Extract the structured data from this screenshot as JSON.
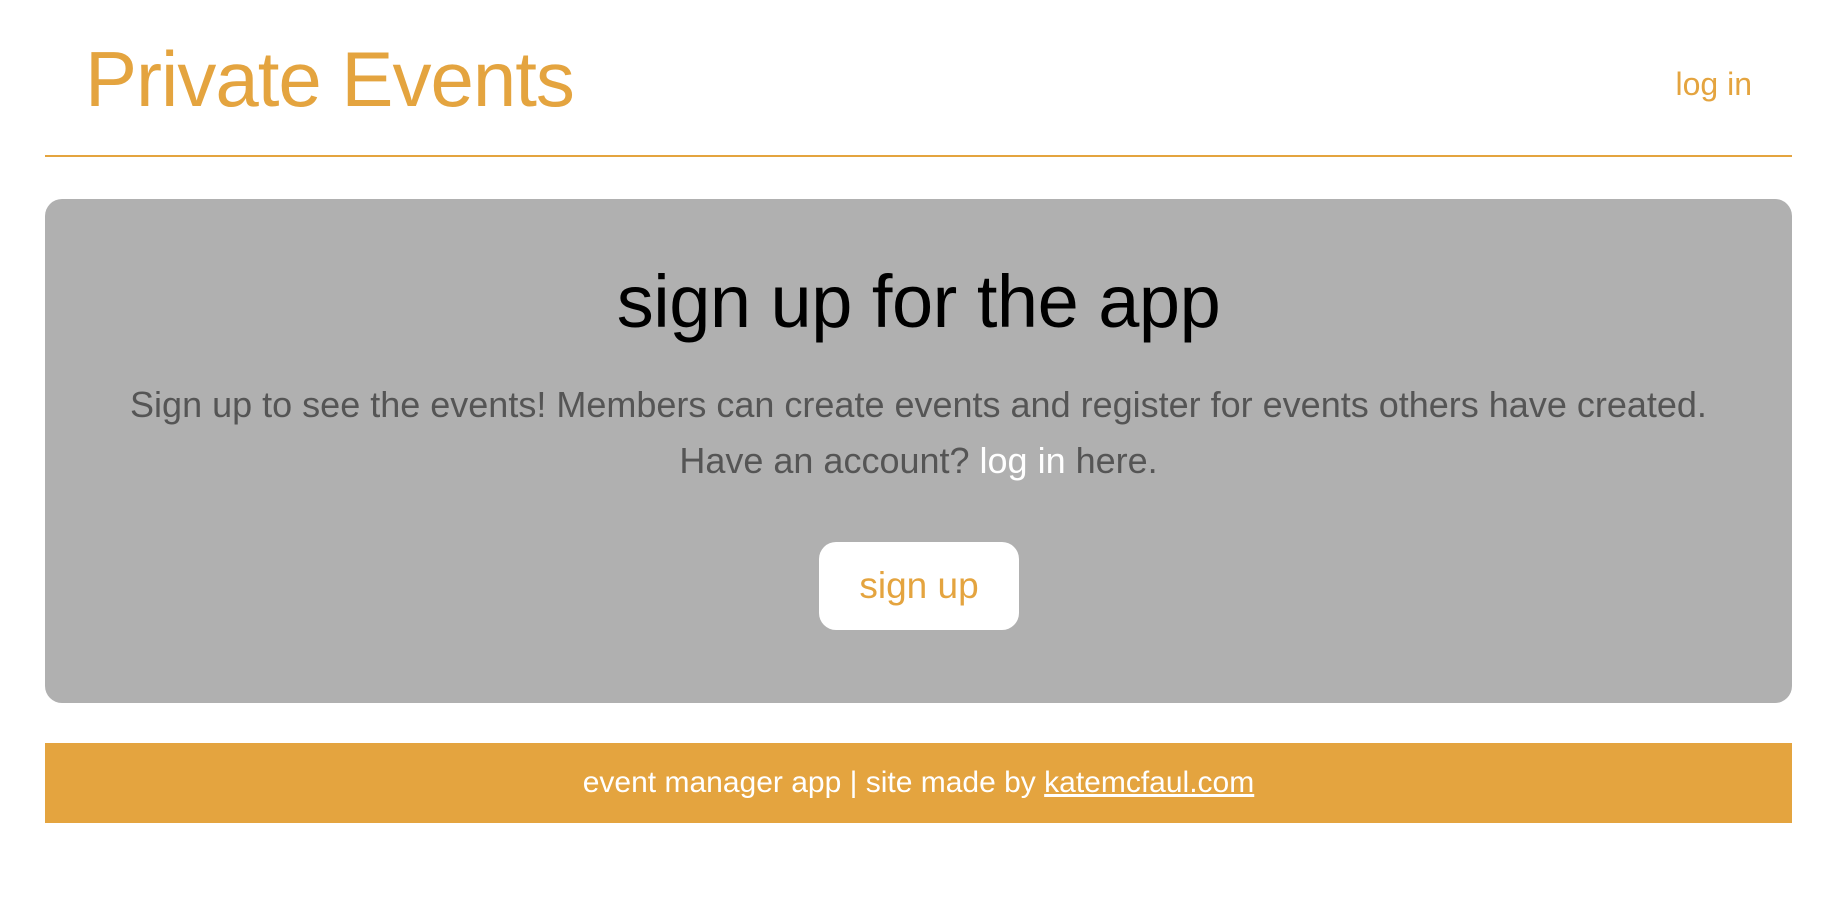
{
  "header": {
    "brand": "Private Events",
    "login_link": "log in"
  },
  "hero": {
    "title": "sign up for the app",
    "description_line1": "Sign up to see the events! Members can create events and register for events others have created.",
    "description_line2_prefix": "Have an account? ",
    "description_line2_link": "log in",
    "description_line2_suffix": " here.",
    "signup_button": "sign up"
  },
  "footer": {
    "text": "event manager app | site made by ",
    "link": "katemcfaul.com"
  },
  "colors": {
    "accent": "#e4a43f",
    "hero_background": "#b0b0b0",
    "hero_text": "#555555",
    "button_background": "#ffffff"
  }
}
